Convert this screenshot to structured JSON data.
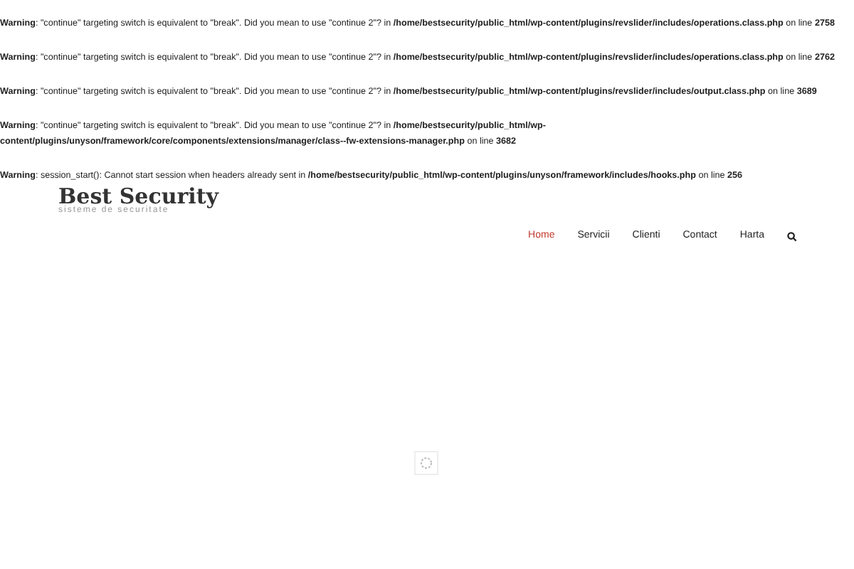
{
  "warnings": [
    "**Warning**: \"continue\" targeting switch is equivalent to \"break\". Did you mean to use \"continue 2\"? in **/home/bestsecurity/public_html/wp-content/plugins/revslider/includes/operations.class.php** on line **2758**",
    "**Warning**: \"continue\" targeting switch is equivalent to \"break\". Did you mean to use \"continue 2\"? in **/home/bestsecurity/public_html/wp-content/plugins/revslider/includes/operations.class.php** on line **2762**",
    "**Warning**: \"continue\" targeting switch is equivalent to \"break\". Did you mean to use \"continue 2\"? in **/home/bestsecurity/public_html/wp-content/plugins/revslider/includes/output.class.php** on line **3689**",
    "**Warning**: \"continue\" targeting switch is equivalent to \"break\". Did you mean to use \"continue 2\"? in **/home/bestsecurity/public_html/wp-content/plugins/unyson/framework/core/components/extensions/manager/class--fw-extensions-manager.php** on line **3682**",
    "**Warning**: session_start(): Cannot start session when headers already sent in **/home/bestsecurity/public_html/wp-content/plugins/unyson/framework/includes/hooks.php** on line **256**"
  ],
  "logo": {
    "title": "Best Security",
    "subtitle": "sisteme de securitate"
  },
  "nav": [
    {
      "label": "Home",
      "selected": true
    },
    {
      "label": "Servicii",
      "selected": false
    },
    {
      "label": "Clienti",
      "selected": false
    },
    {
      "label": "Contact",
      "selected": false
    },
    {
      "label": "Harta",
      "selected": false
    }
  ]
}
